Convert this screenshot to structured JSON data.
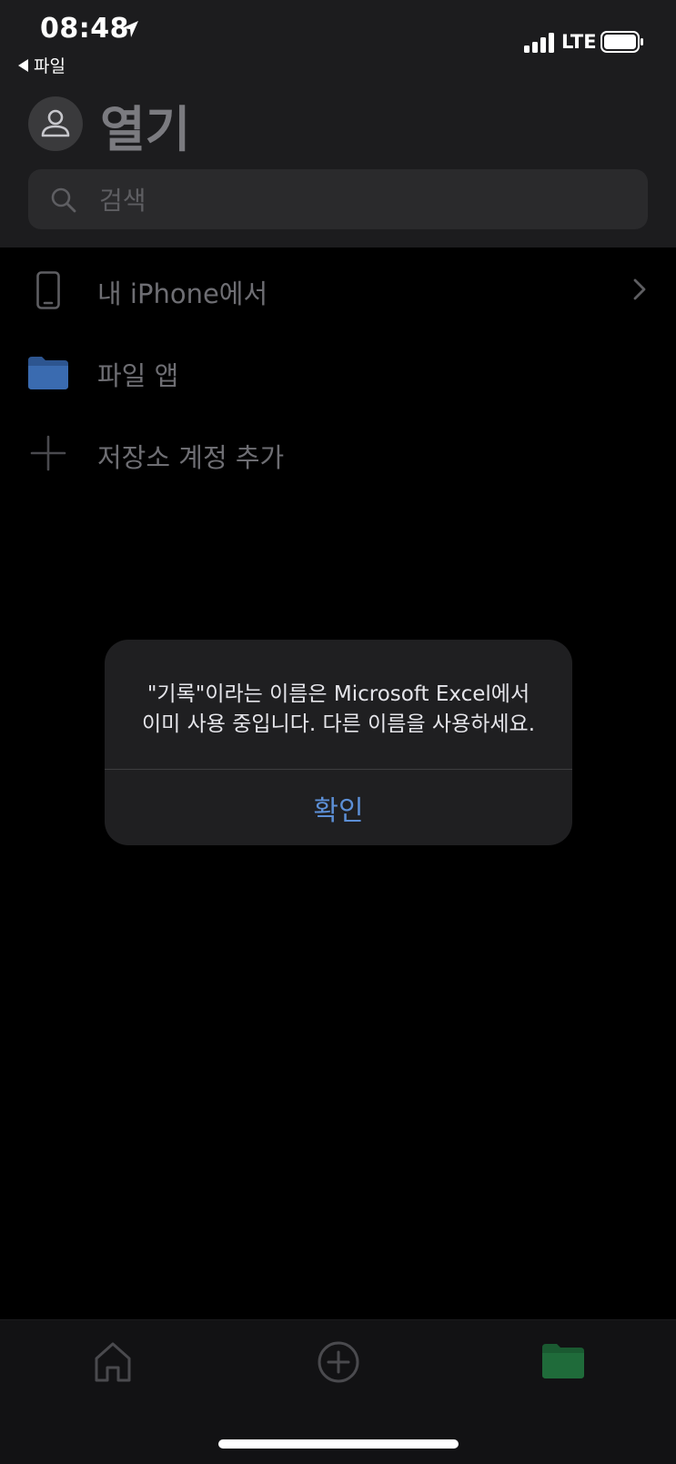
{
  "status_bar": {
    "time": "08:48",
    "network": "LTE"
  },
  "nav": {
    "back_label": "파일",
    "title": "열기"
  },
  "search": {
    "placeholder": "검색"
  },
  "locations": [
    {
      "label": "내 iPhone에서",
      "icon": "phone-icon",
      "has_chevron": true
    },
    {
      "label": "파일 앱",
      "icon": "folder-icon",
      "has_chevron": false
    },
    {
      "label": "저장소 계정 추가",
      "icon": "plus-icon",
      "has_chevron": false
    }
  ],
  "alert": {
    "message_line1": "\"기록\"이라는 이름은 Microsoft Excel에서",
    "message_line2": "이미 사용 중입니다. 다른 이름을 사용하세요.",
    "confirm_label": "확인"
  },
  "tab_bar": {
    "tabs": [
      {
        "icon": "home-icon",
        "active": false
      },
      {
        "icon": "new-icon",
        "active": false
      },
      {
        "icon": "open-folder-icon",
        "active": true
      }
    ]
  },
  "colors": {
    "accent_link": "#5c8fd6",
    "active_tab": "#1f6b3a",
    "folder_blue": "#3a6bb0"
  }
}
